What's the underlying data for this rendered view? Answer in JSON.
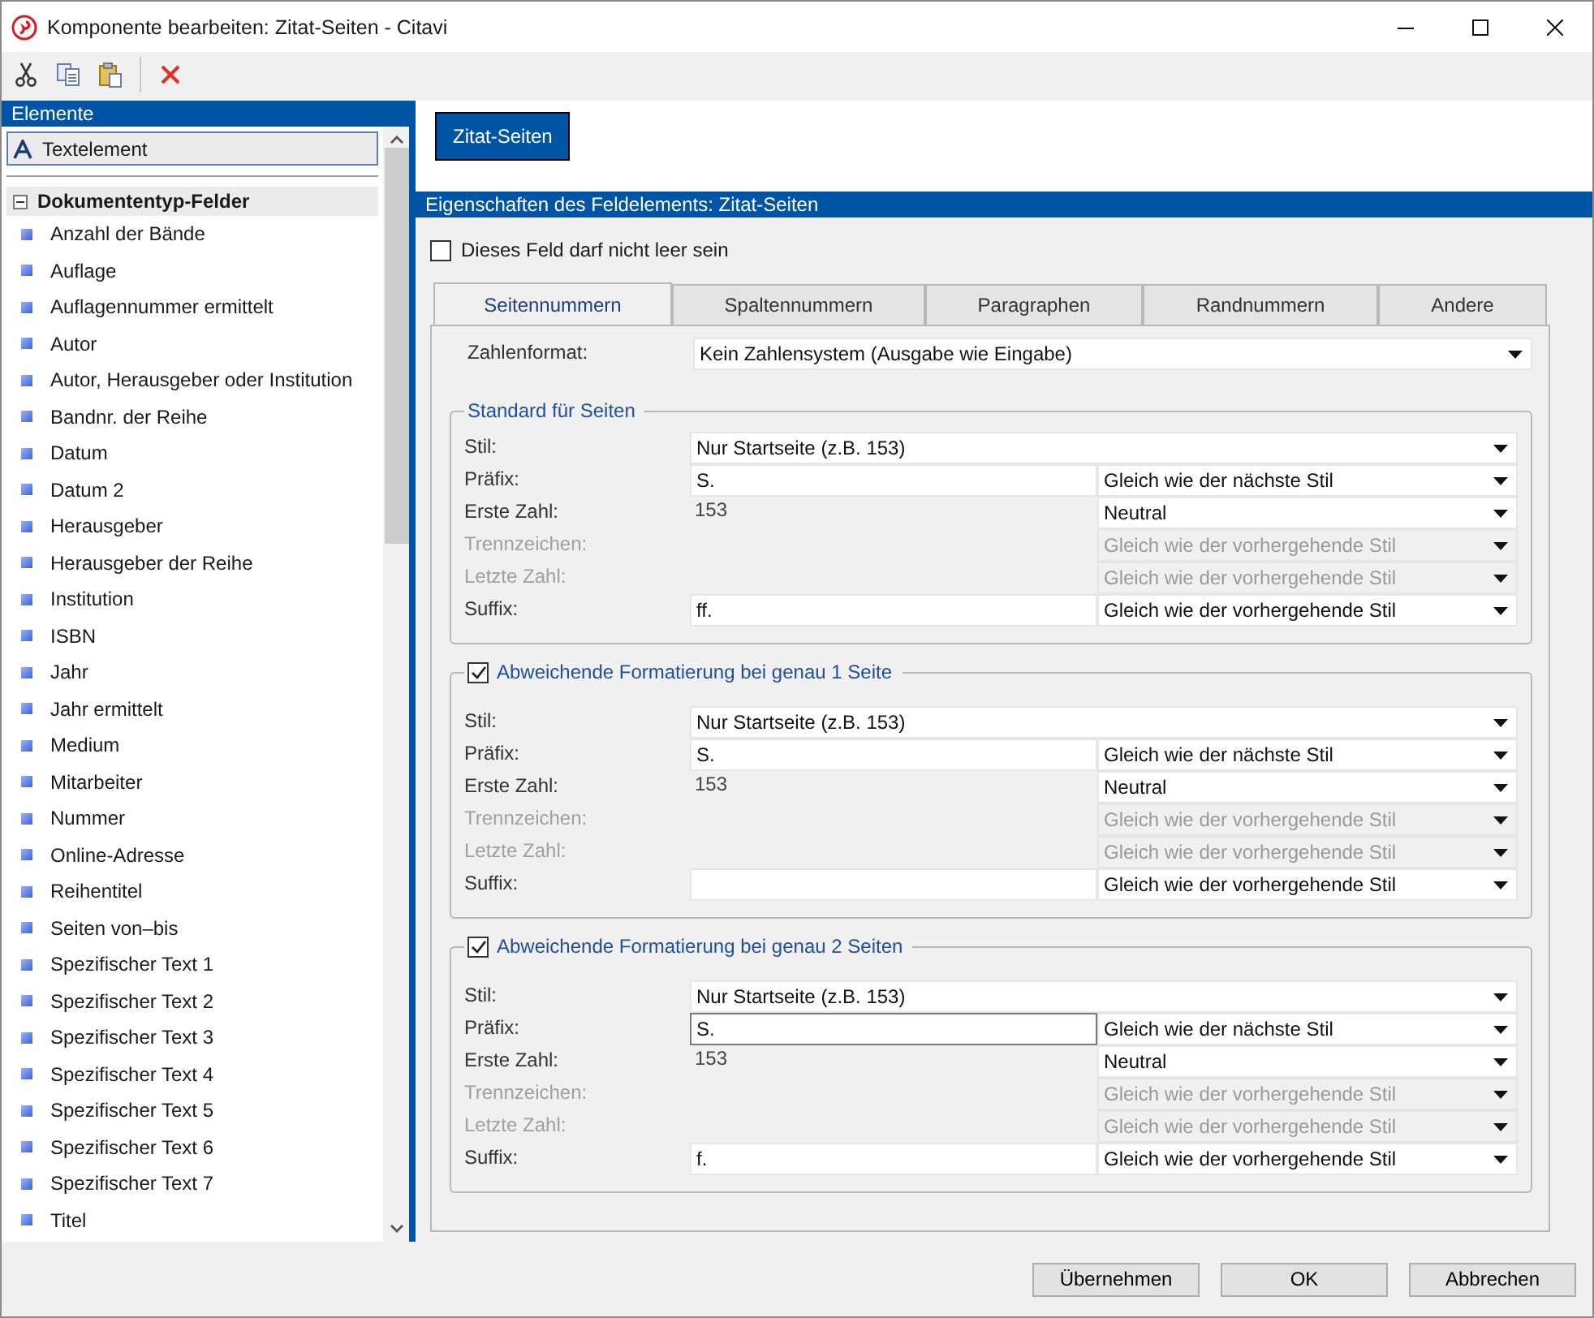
{
  "window": {
    "title": "Komponente bearbeiten: Zitat-Seiten - Citavi"
  },
  "toolbar": [
    {
      "kind": "cut"
    },
    {
      "kind": "copy"
    },
    {
      "kind": "paste"
    },
    {
      "kind": "delete"
    }
  ],
  "sidebar": {
    "title": "Elemente",
    "items": [
      {
        "label": "Textelement",
        "kind": "text",
        "selected": true
      },
      {
        "label": "Dokumententyp-Felder",
        "kind": "category",
        "expanded": true,
        "children": [
          {
            "label": "Anzahl der Bände"
          },
          {
            "label": "Auflage"
          },
          {
            "label": "Auflagennummer ermittelt"
          },
          {
            "label": "Autor"
          },
          {
            "label": "Autor, Herausgeber oder Institution"
          },
          {
            "label": "Bandnr. der Reihe"
          },
          {
            "label": "Datum"
          },
          {
            "label": "Datum 2"
          },
          {
            "label": "Herausgeber"
          },
          {
            "label": "Herausgeber der Reihe"
          },
          {
            "label": "Institution"
          },
          {
            "label": "ISBN"
          },
          {
            "label": "Jahr"
          },
          {
            "label": "Jahr ermittelt"
          },
          {
            "label": "Medium"
          },
          {
            "label": "Mitarbeiter"
          },
          {
            "label": "Nummer"
          },
          {
            "label": "Online-Adresse"
          },
          {
            "label": "Reihentitel"
          },
          {
            "label": "Seiten von–bis"
          },
          {
            "label": "Spezifischer Text 1"
          },
          {
            "label": "Spezifischer Text 2"
          },
          {
            "label": "Spezifischer Text 3"
          },
          {
            "label": "Spezifischer Text 4"
          },
          {
            "label": "Spezifischer Text 5"
          },
          {
            "label": "Spezifischer Text 6"
          },
          {
            "label": "Spezifischer Text 7"
          },
          {
            "label": "Titel"
          }
        ]
      }
    ]
  },
  "element_button": "Zitat-Seiten",
  "properties": {
    "title": "Eigenschaften des Feldelements:  Zitat-Seiten",
    "required_checkbox": {
      "label": "Dieses Feld darf nicht leer sein",
      "checked": false
    },
    "tabs": [
      {
        "label": "Seitennummern",
        "selected": true
      },
      {
        "label": "Spaltennummern",
        "selected": false
      },
      {
        "label": "Paragraphen",
        "selected": false
      },
      {
        "label": "Randnummern",
        "selected": false
      },
      {
        "label": "Andere",
        "selected": false
      }
    ],
    "number_format": {
      "label": "Zahlenformat:",
      "value": "Kein Zahlensystem (Ausgabe wie Eingabe)"
    },
    "groups": [
      {
        "kind": "plain",
        "title": "Standard für Seiten",
        "rows": [
          {
            "kind": "wide_select",
            "label": "Stil:",
            "value": "Nur Startseite (z.B. 153)",
            "disabled": false
          },
          {
            "kind": "input_select",
            "label": "Präfix:",
            "value": "S.",
            "focused": false,
            "select": "Gleich wie der nächste Stil",
            "disabled": false
          },
          {
            "kind": "static_select",
            "label": "Erste Zahl:",
            "value": "153",
            "select": "Neutral",
            "disabled": false
          },
          {
            "kind": "blank_select",
            "label": "Trennzeichen:",
            "select": "Gleich wie der vorhergehende Stil",
            "disabled": true
          },
          {
            "kind": "blank_select",
            "label": "Letzte Zahl:",
            "select": "Gleich wie der vorhergehende Stil",
            "disabled": true
          },
          {
            "kind": "input_select",
            "label": "Suffix:",
            "value": "ff.",
            "focused": false,
            "select": "Gleich wie der vorhergehende Stil",
            "disabled": false
          }
        ]
      },
      {
        "kind": "checkable",
        "title": "Abweichende Formatierung bei genau 1 Seite",
        "checked": true,
        "rows": [
          {
            "kind": "wide_select",
            "label": "Stil:",
            "value": "Nur Startseite (z.B. 153)",
            "disabled": false
          },
          {
            "kind": "input_select",
            "label": "Präfix:",
            "value": "S.",
            "focused": false,
            "select": "Gleich wie der nächste Stil",
            "disabled": false
          },
          {
            "kind": "static_select",
            "label": "Erste Zahl:",
            "value": "153",
            "select": "Neutral",
            "disabled": false
          },
          {
            "kind": "blank_select",
            "label": "Trennzeichen:",
            "select": "Gleich wie der vorhergehende Stil",
            "disabled": true
          },
          {
            "kind": "blank_select",
            "label": "Letzte Zahl:",
            "select": "Gleich wie der vorhergehende Stil",
            "disabled": true
          },
          {
            "kind": "input_select",
            "label": "Suffix:",
            "focused": false,
            "select": "Gleich wie der vorhergehende Stil",
            "disabled": false
          }
        ]
      },
      {
        "kind": "checkable",
        "title": "Abweichende Formatierung bei genau 2 Seiten",
        "checked": true,
        "rows": [
          {
            "kind": "wide_select",
            "label": "Stil:",
            "value": "Nur Startseite (z.B. 153)",
            "disabled": false
          },
          {
            "kind": "input_select",
            "label": "Präfix:",
            "value": "S.",
            "focused": true,
            "select": "Gleich wie der nächste Stil",
            "disabled": false
          },
          {
            "kind": "static_select",
            "label": "Erste Zahl:",
            "value": "153",
            "select": "Neutral",
            "disabled": false
          },
          {
            "kind": "blank_select",
            "label": "Trennzeichen:",
            "select": "Gleich wie der vorhergehende Stil",
            "disabled": true
          },
          {
            "kind": "blank_select",
            "label": "Letzte Zahl:",
            "select": "Gleich wie der vorhergehende Stil",
            "disabled": true
          },
          {
            "kind": "input_select",
            "label": "Suffix:",
            "value": "f.",
            "focused": false,
            "select": "Gleich wie der vorhergehende Stil",
            "disabled": false
          }
        ]
      }
    ]
  },
  "buttons": [
    "Übernehmen",
    "OK",
    "Abbrechen"
  ]
}
